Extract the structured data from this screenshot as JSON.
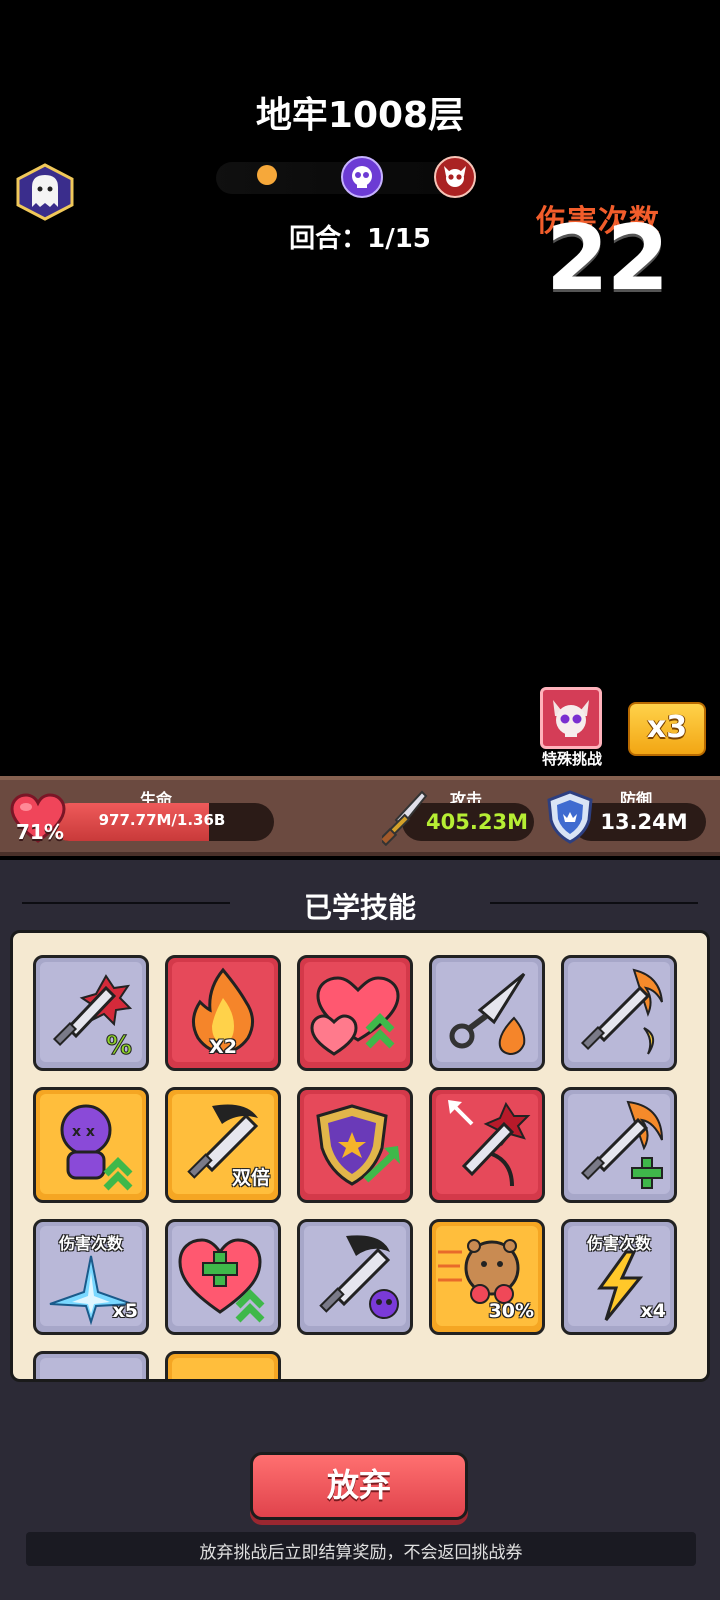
{
  "header": {
    "title": "地牢1008层",
    "round_label": "回合：",
    "round_value": "1/15",
    "damage_label": "伤害次数",
    "damage_count": "22"
  },
  "special": {
    "label": "特殊挑战",
    "multiplier": "x3"
  },
  "stats": {
    "hp_label": "生命",
    "hp_value": "977.77M/1.36B",
    "hp_percent": "71%",
    "hp_fraction": 0.71,
    "atk_label": "攻击",
    "atk_value": "405.23M",
    "def_label": "防御",
    "def_value": "13.24M"
  },
  "skills_section": {
    "title": "已学技能",
    "skills": [
      {
        "icon": "sword-crit-percent-icon",
        "frame": "gray",
        "badge": "",
        "top_label": ""
      },
      {
        "icon": "fire-x2-icon",
        "frame": "red",
        "badge": "X2",
        "top_label": ""
      },
      {
        "icon": "hearts-up-icon",
        "frame": "red",
        "badge": "",
        "top_label": ""
      },
      {
        "icon": "kunai-fire-icon",
        "frame": "gray",
        "badge": "",
        "top_label": ""
      },
      {
        "icon": "flaming-sword-moon-icon",
        "frame": "gray",
        "badge": "",
        "top_label": ""
      },
      {
        "icon": "purple-doll-up-icon",
        "frame": "gold",
        "badge": "",
        "top_label": ""
      },
      {
        "icon": "sword-double-icon",
        "frame": "gold",
        "badge": "双倍",
        "top_label": ""
      },
      {
        "icon": "shield-up-icon",
        "frame": "red",
        "badge": "",
        "top_label": ""
      },
      {
        "icon": "sword-split-icon",
        "frame": "red",
        "badge": "",
        "top_label": ""
      },
      {
        "icon": "flaming-sword-plus-icon",
        "frame": "gray",
        "badge": "",
        "top_label": ""
      },
      {
        "icon": "ice-burst-icon",
        "frame": "gray",
        "badge": "x5",
        "top_label": "伤害次数"
      },
      {
        "icon": "heart-plus-up-icon",
        "frame": "gray",
        "badge": "",
        "top_label": ""
      },
      {
        "icon": "sword-skull-icon",
        "frame": "gray",
        "badge": "",
        "top_label": ""
      },
      {
        "icon": "capybara-icon",
        "frame": "gold",
        "badge": "30%",
        "top_label": ""
      },
      {
        "icon": "lightning-icon",
        "frame": "gray",
        "badge": "x4",
        "top_label": "伤害次数"
      },
      {
        "icon": "partial-icon",
        "frame": "gray",
        "badge": "",
        "top_label": ""
      },
      {
        "icon": "partial-icon",
        "frame": "gold",
        "badge": "",
        "top_label": ""
      }
    ]
  },
  "footer": {
    "giveup_label": "放弃",
    "note": "放弃挑战后立即结算奖励，不会返回挑战券"
  },
  "colors": {
    "hp_red": "#e04848",
    "atk_green": "#b6ee34",
    "damage_orange": "#f25d2b",
    "gold_button": "#f5b42a"
  }
}
